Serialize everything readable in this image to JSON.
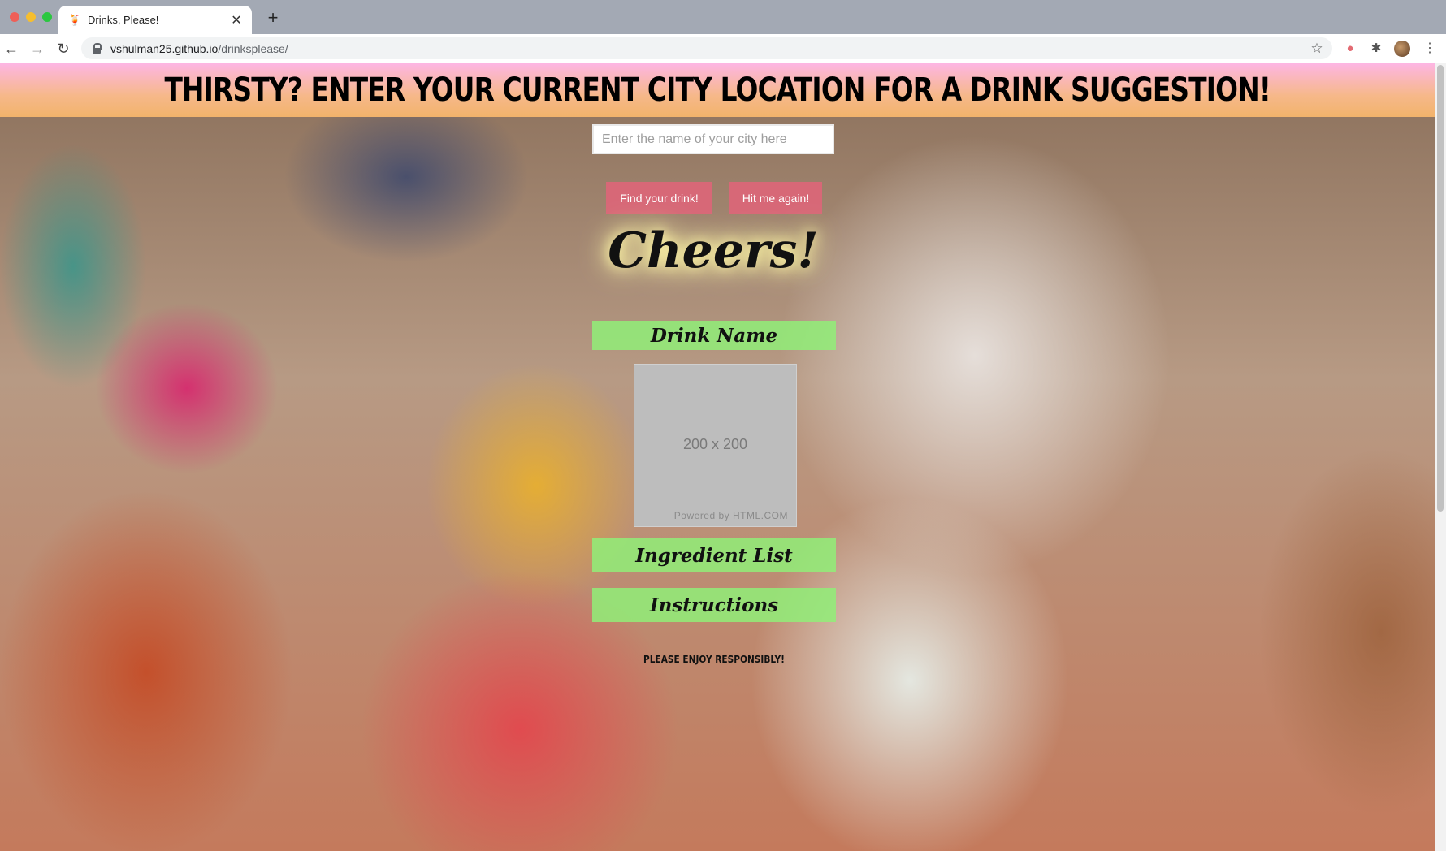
{
  "browser": {
    "tab_title": "Drinks, Please!",
    "tab_favicon": "cocktail-icon",
    "url_domain": "vshulman25.github.io",
    "url_path": "/drinksplease/"
  },
  "page": {
    "header_title": "THIRSTY? ENTER YOUR CURRENT CITY LOCATION FOR A DRINK SUGGESTION!",
    "city_placeholder": "Enter the name of your city here",
    "find_button": "Find your drink!",
    "again_button": "Hit me again!",
    "cheers": "Cheers!",
    "drink_name": "Drink Name",
    "image_placeholder": "200 x 200",
    "image_powered": "Powered by HTML.COM",
    "ingredient_list": "Ingredient List",
    "instructions": "Instructions",
    "footer_note": "PLEASE ENJOY RESPONSIBLY!"
  },
  "colors": {
    "header_top": "#fdb6e3",
    "header_bottom": "#f2b36b",
    "button": "#d76877",
    "label_bar": "#90ee78"
  }
}
